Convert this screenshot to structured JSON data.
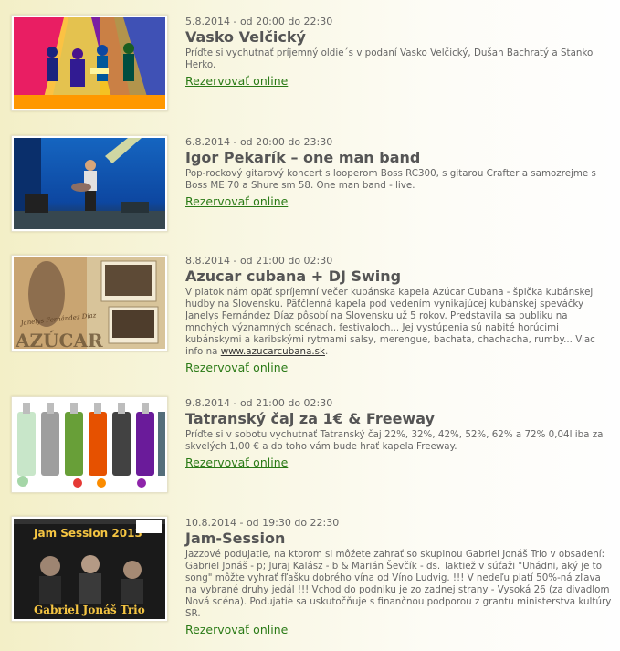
{
  "events": [
    {
      "date": "5.8.2014 - od 20:00 do 22:30",
      "title": "Vasko Velčický",
      "description": "Príďte si vychutnať príjemný oldie´s v podaní Vasko Velčický, Dušan Bachratý a Stanko Herko.",
      "reserve_label": "Rezervovať online",
      "image": "band-on-stage-illustration"
    },
    {
      "date": "6.8.2014 - od 20:00 do 23:30",
      "title": "Igor Pekarík – one man band",
      "description": "Pop-rockový gitarový koncert s looperom Boss RC300, s gitarou Crafter a samozrejme s Boss ME 70 a Shure sm 58. One man band - live.",
      "reserve_label": "Rezervovať online",
      "image": "guitarist-on-stage-photo"
    },
    {
      "date": "8.8.2014 - od 21:00 do 02:30",
      "title": "Azucar cubana + DJ Swing",
      "description": "V piatok nám opäť spríjemní večer kubánska kapela Azúcar Cubana - špička kubánskej hudby na Slovensku. Päťčlenná kapela pod vedením vynikajúcej kubánskej speváčky Janelys Fernández Díaz pôsobí na Slovensku už 5 rokov. Predstavila sa publiku na mnohých významných scénach, festivaloch... Jej vystúpenia sú nabité horúcimi kubánskymi a karibskými rytmami salsy, merengue, bachata, chachacha, rumby... Viac info na ",
      "link_text": "www.azucarcubana.sk",
      "link_suffix": ".",
      "reserve_label": "Rezervovať online",
      "image": "azucar-cubana-poster",
      "image_text": {
        "singer": "Janelys Fernández Díaz",
        "band": "AZÚCAR"
      }
    },
    {
      "date": "9.8.2014 - od 21:00 do 02:30",
      "title": "Tatranský čaj za 1€ & Freeway",
      "description": "Príďte si v sobotu vychutnať Tatranský čaj 22%, 32%, 42%, 52%, 62% a 72% 0,04l iba za skvelých 1,00 € a do toho vám bude hrať kapela Freeway.",
      "reserve_label": "Rezervovať online",
      "image": "tatransky-caj-bottles"
    },
    {
      "date": "10.8.2014 - od 19:30 do 22:30",
      "title": "Jam-Session",
      "description": "Jazzové podujatie, na ktorom si môžete zahrať so skupinou Gabriel Jonáš Trio v obsadení: Gabriel Jonáš - p; Juraj Kalász - b & Marián Ševčík - ds. Taktiež v súťaži \"Uhádni, aký je to song\" môžte vyhrať fľašku dobrého vína od Víno Ludvig. !!! V nedeľu platí 50%-ná zľava na vybrané druhy jedál !!! Vchod do podniku je zo zadnej strany - Vysoká 26 (za divadlom Nová scéna). Podujatie sa uskutočňuje s finančnou podporou z grantu ministerstva kultúry SR.",
      "reserve_label": "Rezervovať online",
      "image": "jam-session-poster",
      "image_text": {
        "headline": "Jam Session 2013",
        "footer": "Gabriel Jonáš Trio"
      }
    }
  ],
  "colors": {
    "link_green": "#2a7a16",
    "title_gray": "#555555",
    "text_gray": "#666666"
  }
}
